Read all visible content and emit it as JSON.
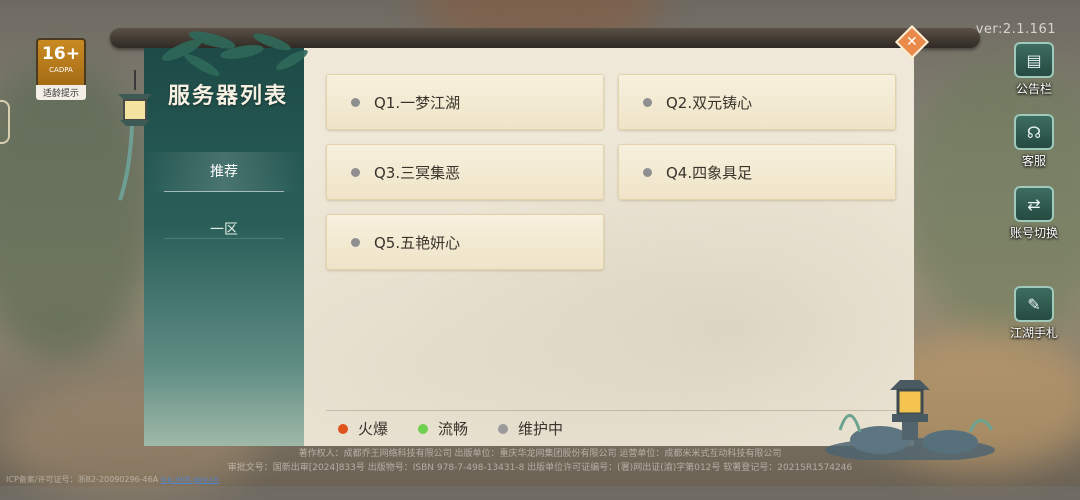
{
  "version": "ver:2.1.161",
  "age_badge": {
    "age": "16+",
    "org": "CADPA",
    "tip": "适龄提示"
  },
  "panel": {
    "title": "服务器列表",
    "nav": [
      {
        "label": "推荐",
        "active": true
      },
      {
        "label": "一区",
        "active": false
      }
    ],
    "servers": [
      {
        "name": "Q1.一梦江湖",
        "status": "维护中"
      },
      {
        "name": "Q2.双元铸心",
        "status": "维护中"
      },
      {
        "name": "Q3.三冥集恶",
        "status": "维护中"
      },
      {
        "name": "Q4.四象具足",
        "status": "维护中"
      },
      {
        "name": "Q5.五艳妍心",
        "status": "维护中"
      }
    ],
    "legend": [
      {
        "label": "火爆",
        "color": "#e0531f"
      },
      {
        "label": "流畅",
        "color": "#6fcf4f"
      },
      {
        "label": "维护中",
        "color": "#9a9a9a"
      }
    ]
  },
  "side_menu": {
    "notice": "公告栏",
    "service": "客服",
    "switch_account": "账号切换",
    "handbook": "江湖手札"
  },
  "footer": {
    "line1": "著作权人：成都乔王网络科技有限公司  出版单位：重庆华龙网集团股份有限公司  运营单位：成都米米式互动科技有限公司",
    "line2": "审批文号：国新出审[2024]833号  出版物号：ISBN 978-7-498-13431-8  出版单位许可证编号：(署)网出证(渝)字第012号  软著登记号：2021SR1574246",
    "icp": "ICP备案/许可证号：浙B2-20090296-46A",
    "icp_link": "icp.miit.gov.cn"
  },
  "colors": {
    "accent": "#e98a4a",
    "sidebar": "#1d4a46",
    "panel_bg": "#efe8d8"
  }
}
